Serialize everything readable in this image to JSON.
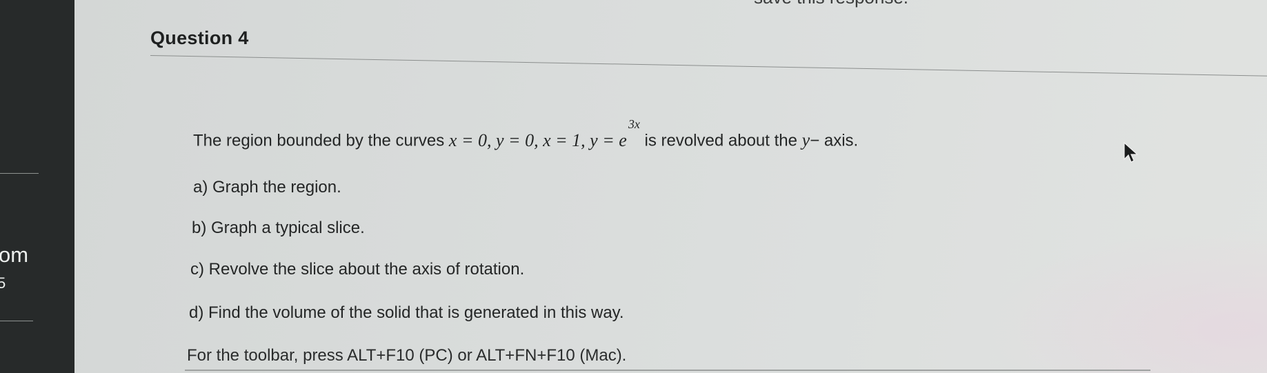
{
  "browser_fragment": "save this response.",
  "sidebar": {
    "fragment_1": "om",
    "fragment_2": "5"
  },
  "question": {
    "title": "Question 4",
    "stem": {
      "lead": "The region bounded by the curves",
      "equations": "x = 0, y = 0, x = 1, y = e",
      "exponent": "3x",
      "tail_pre": "is revolved about the",
      "axis_var": "y",
      "tail_post": "− axis."
    },
    "parts": [
      "a) Graph the region.",
      "b) Graph a typical slice.",
      "c) Revolve the slice about the axis of rotation.",
      "d) Find the volume of the solid that is generated in this way."
    ],
    "toolbar_hint": "For the toolbar, press ALT+F10 (PC) or ALT+FN+F10 (Mac)."
  },
  "colors": {
    "card_background": "#d9dcdb",
    "sidebar_dark": "#272a2a",
    "text": "#242626"
  },
  "icons": {
    "pointer": "mouse-pointer-icon"
  }
}
